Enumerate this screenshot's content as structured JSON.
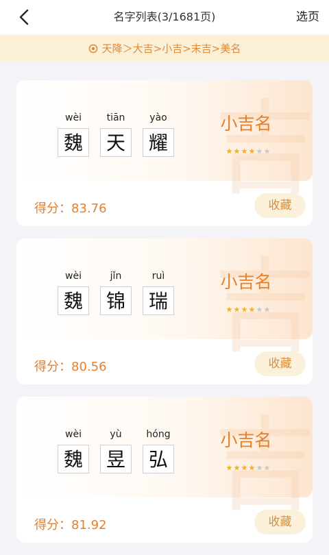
{
  "header": {
    "title": "名字列表(3/1681页)",
    "right_action": "选页"
  },
  "level_path": "天降＞大吉>小吉>末吉>美名",
  "colors": {
    "accent": "#e57f2b",
    "banner_bg": "#fbefd5",
    "button_bg": "#fbf1da"
  },
  "cards": [
    {
      "chars": [
        {
          "pinyin": "wèi",
          "hanzi": "魏"
        },
        {
          "pinyin": "tiān",
          "hanzi": "天"
        },
        {
          "pinyin": "yào",
          "hanzi": "耀"
        }
      ],
      "level": "小吉名",
      "watermark": "吉",
      "rating": 4,
      "rating_max": 6,
      "score": "得分：83.76",
      "fav_label": "收藏"
    },
    {
      "chars": [
        {
          "pinyin": "wèi",
          "hanzi": "魏"
        },
        {
          "pinyin": "jǐn",
          "hanzi": "锦"
        },
        {
          "pinyin": "ruì",
          "hanzi": "瑞"
        }
      ],
      "level": "小吉名",
      "watermark": "吉",
      "rating": 4,
      "rating_max": 6,
      "score": "得分：80.56",
      "fav_label": "收藏"
    },
    {
      "chars": [
        {
          "pinyin": "wèi",
          "hanzi": "魏"
        },
        {
          "pinyin": "yù",
          "hanzi": "昱"
        },
        {
          "pinyin": "hóng",
          "hanzi": "弘"
        }
      ],
      "level": "小吉名",
      "watermark": "吉",
      "rating": 4,
      "rating_max": 6,
      "score": "得分：81.92",
      "fav_label": "收藏"
    }
  ]
}
